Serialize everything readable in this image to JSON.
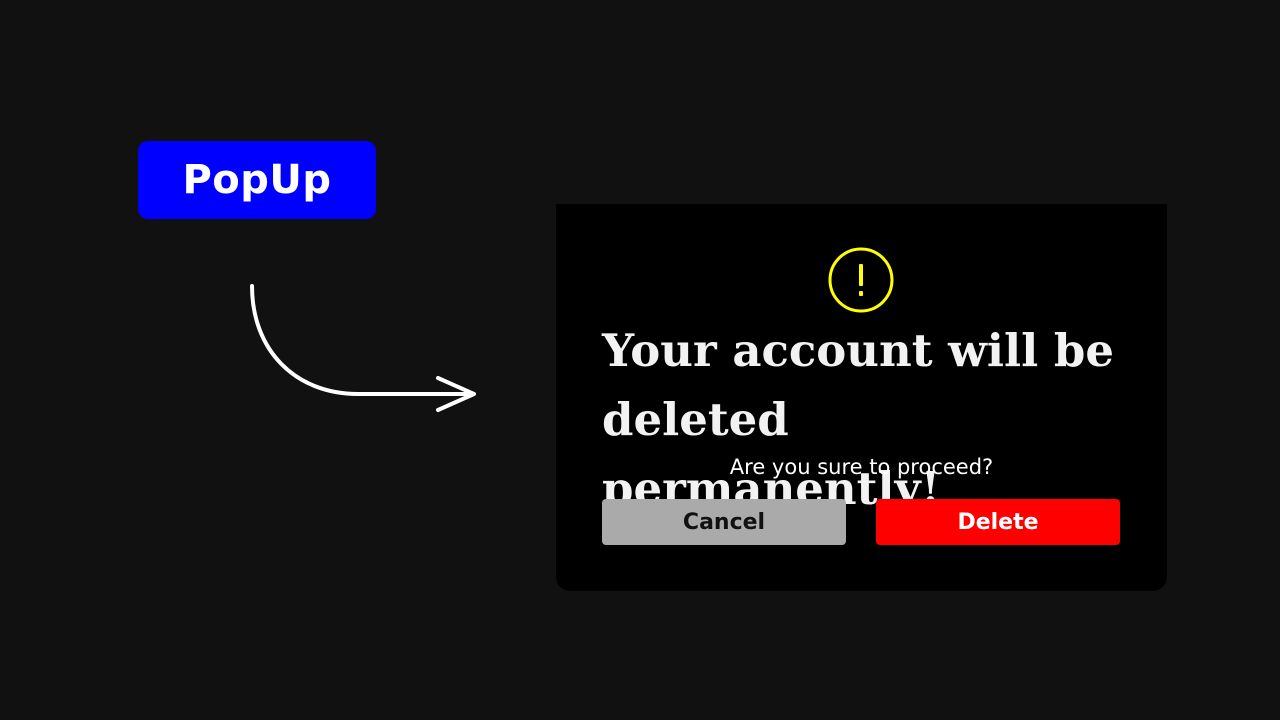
{
  "trigger": {
    "label": "PopUp"
  },
  "dialog": {
    "icon": "warning-icon",
    "title": "Your account will be deleted permanently!",
    "subtitle": "Are you sure to proceed?",
    "cancel_label": "Cancel",
    "delete_label": "Delete"
  },
  "colors": {
    "background": "#111111",
    "trigger": "#0000ff",
    "dialog": "#000000",
    "warning": "#ffff00",
    "cancel": "#aaaaaa",
    "delete": "#ff0000"
  }
}
